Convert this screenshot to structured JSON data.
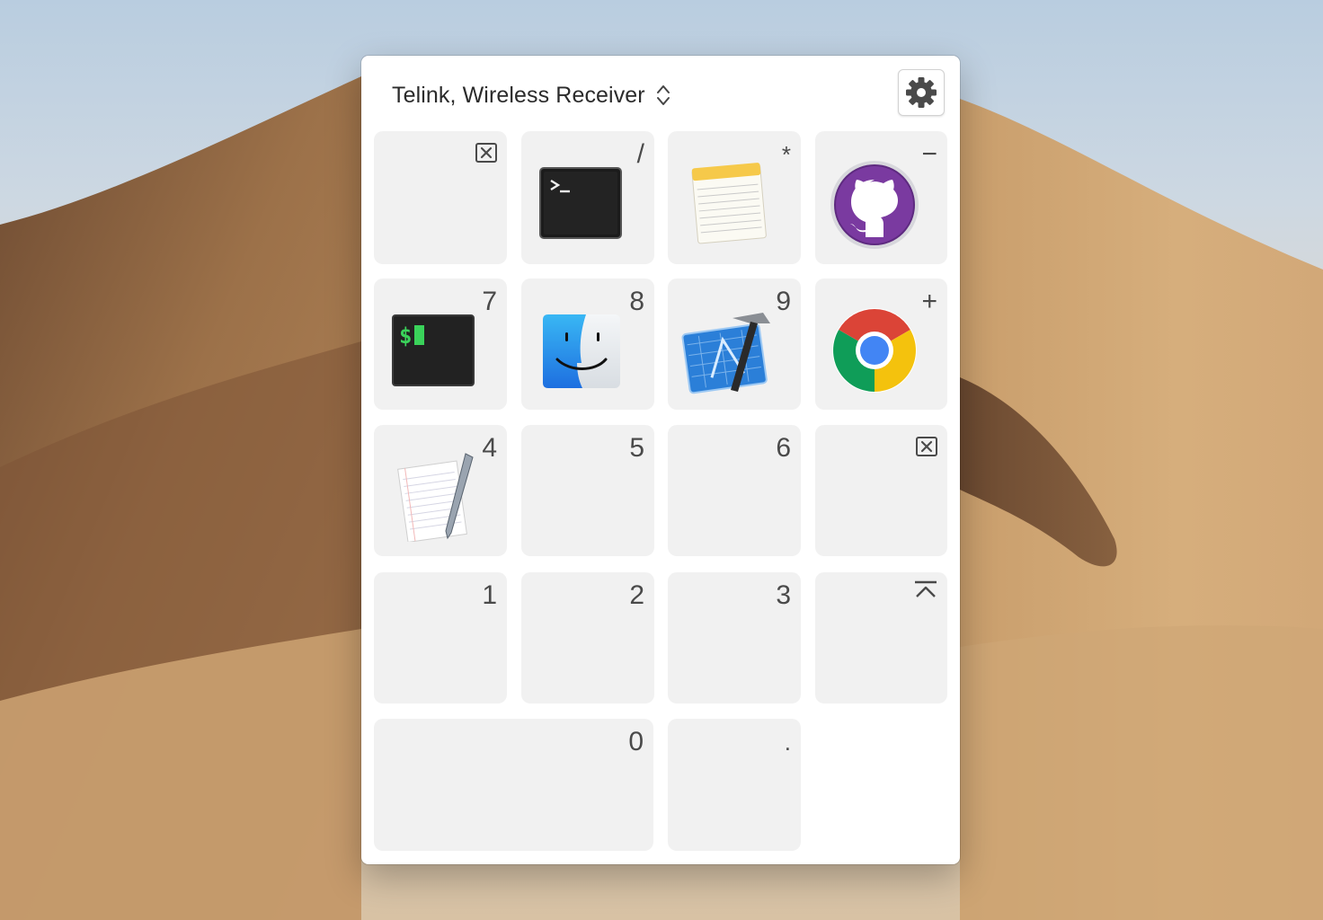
{
  "device": {
    "name": "Telink, Wireless Receiver"
  },
  "keys": {
    "clear": {
      "icon": "clear-key-icon"
    },
    "slash": {
      "label": "/",
      "app": "terminal-app-icon"
    },
    "asterisk": {
      "label": "*",
      "app": "notes-app-icon"
    },
    "minus": {
      "label": "−",
      "app": "github-app-icon"
    },
    "k7": {
      "label": "7",
      "app": "iterm-app-icon"
    },
    "k8": {
      "label": "8",
      "app": "finder-app-icon"
    },
    "k9": {
      "label": "9",
      "app": "xcode-app-icon"
    },
    "plus": {
      "label": "+",
      "app": "chrome-app-icon"
    },
    "k4": {
      "label": "4",
      "app": "textedit-app-icon"
    },
    "k5": {
      "label": "5"
    },
    "k6": {
      "label": "6"
    },
    "del": {
      "icon": "delete-key-icon"
    },
    "k1": {
      "label": "1"
    },
    "k2": {
      "label": "2"
    },
    "k3": {
      "label": "3"
    },
    "enter": {
      "icon": "enter-key-icon"
    },
    "k0": {
      "label": "0"
    },
    "dot": {
      "label": "."
    }
  },
  "colors": {
    "key_bg": "#f1f1f1",
    "panel_bg": "#ffffff",
    "label": "#4a4a4a"
  }
}
